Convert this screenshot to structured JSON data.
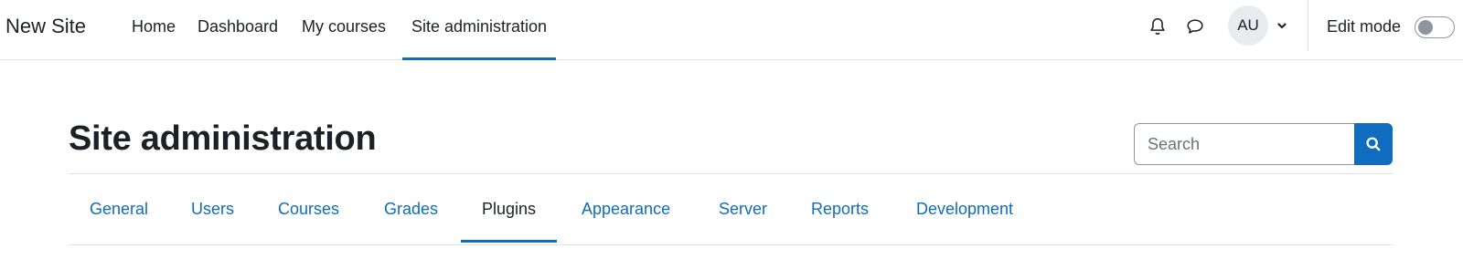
{
  "navbar": {
    "brand": "New Site",
    "items": [
      {
        "label": "Home"
      },
      {
        "label": "Dashboard"
      },
      {
        "label": "My courses"
      },
      {
        "label": "Site administration",
        "active": true
      }
    ],
    "notifications_icon": "bell-icon",
    "messages_icon": "chat-bubble-icon",
    "user_initials": "AU",
    "user_menu_icon": "chevron-down-icon",
    "edit_mode_label": "Edit mode",
    "edit_mode_on": false
  },
  "page": {
    "title": "Site administration",
    "search": {
      "placeholder": "Search",
      "value": "",
      "button_icon": "search-icon"
    }
  },
  "tabs": [
    {
      "label": "General"
    },
    {
      "label": "Users"
    },
    {
      "label": "Courses"
    },
    {
      "label": "Grades"
    },
    {
      "label": "Plugins",
      "active": true
    },
    {
      "label": "Appearance"
    },
    {
      "label": "Server"
    },
    {
      "label": "Reports"
    },
    {
      "label": "Development"
    }
  ],
  "colors": {
    "accent": "#0f6cbf",
    "text": "#1d2125",
    "border": "#dee2e6",
    "avatar_bg": "#e9ecef",
    "toggle_off": "#8f959e"
  }
}
